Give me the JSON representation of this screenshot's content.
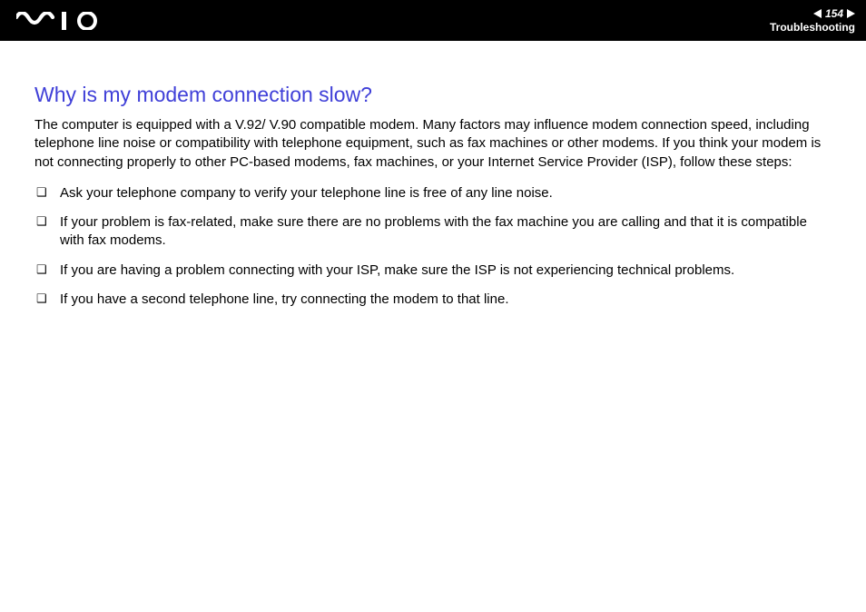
{
  "header": {
    "page_number": "154",
    "section": "Troubleshooting"
  },
  "content": {
    "heading": "Why is my modem connection slow?",
    "intro": "The computer is equipped with a V.92/ V.90 compatible modem. Many factors may influence modem connection speed, including telephone line noise or compatibility with telephone equipment, such as fax machines or other modems. If you think your modem is not connecting properly to other PC-based modems, fax machines, or your Internet Service Provider (ISP), follow these steps:",
    "steps": [
      "Ask your telephone company to verify your telephone line is free of any line noise.",
      "If your problem is fax-related, make sure there are no problems with the fax machine you are calling and that it is compatible with fax modems.",
      "If you are having a problem connecting with your ISP, make sure the ISP is not experiencing technical problems.",
      "If you have a second telephone line, try connecting the modem to that line."
    ]
  }
}
